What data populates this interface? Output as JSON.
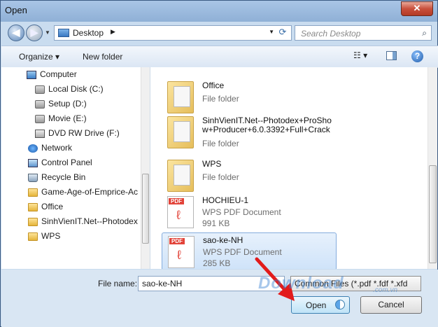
{
  "window": {
    "title": "Open",
    "close_glyph": "✕"
  },
  "nav": {
    "back_glyph": "◀",
    "forward_glyph": "▶",
    "address": "Desktop",
    "address_arrow": "▶",
    "refresh_glyph": "⟳",
    "search_placeholder": "Search Desktop"
  },
  "toolbar": {
    "organize_label": "Organize ▾",
    "new_folder_label": "New folder",
    "views_glyph": "☷ ▾",
    "help_glyph": "?"
  },
  "sidebar": {
    "items": [
      {
        "label": "Computer",
        "icon": "computer-icon"
      },
      {
        "label": "Local Disk (C:)",
        "icon": "disk-icon"
      },
      {
        "label": "Setup (D:)",
        "icon": "disk-icon"
      },
      {
        "label": "Movie  (E:)",
        "icon": "disk-icon"
      },
      {
        "label": "DVD RW Drive (F:)",
        "icon": "dvd-icon"
      },
      {
        "label": "Network",
        "icon": "network-icon"
      },
      {
        "label": "Control Panel",
        "icon": "control-panel-icon"
      },
      {
        "label": "Recycle Bin",
        "icon": "recycle-bin-icon"
      },
      {
        "label": "Game-Age-of-Emprice-Ac",
        "icon": "folder-icon"
      },
      {
        "label": "Office",
        "icon": "folder-icon"
      },
      {
        "label": "SinhVienIT.Net--Photodex",
        "icon": "folder-icon"
      },
      {
        "label": "WPS",
        "icon": "folder-icon"
      }
    ]
  },
  "files": [
    {
      "name": "Office",
      "type": "File folder"
    },
    {
      "name": "SinhVienIT.Net--Photodex+ProShow+Producer+6.0.3392+Full+Crack",
      "type": "File folder"
    },
    {
      "name": "WPS",
      "type": "File folder"
    },
    {
      "name": "HOCHIEU-1",
      "type": "WPS PDF Document",
      "size": "991 KB",
      "badge": "PDF"
    },
    {
      "name": "sao-ke-NH",
      "type": "WPS PDF Document",
      "size": "285 KB",
      "badge": "PDF"
    }
  ],
  "bottom": {
    "file_name_label": "File name:",
    "file_name_value": "sao-ke-NH",
    "filter": "Common Files (*.pdf *.fdf *.xfd",
    "open_label": "Open",
    "cancel_label": "Cancel"
  },
  "watermark": {
    "text": "Download",
    "sub": ".com.vn"
  }
}
